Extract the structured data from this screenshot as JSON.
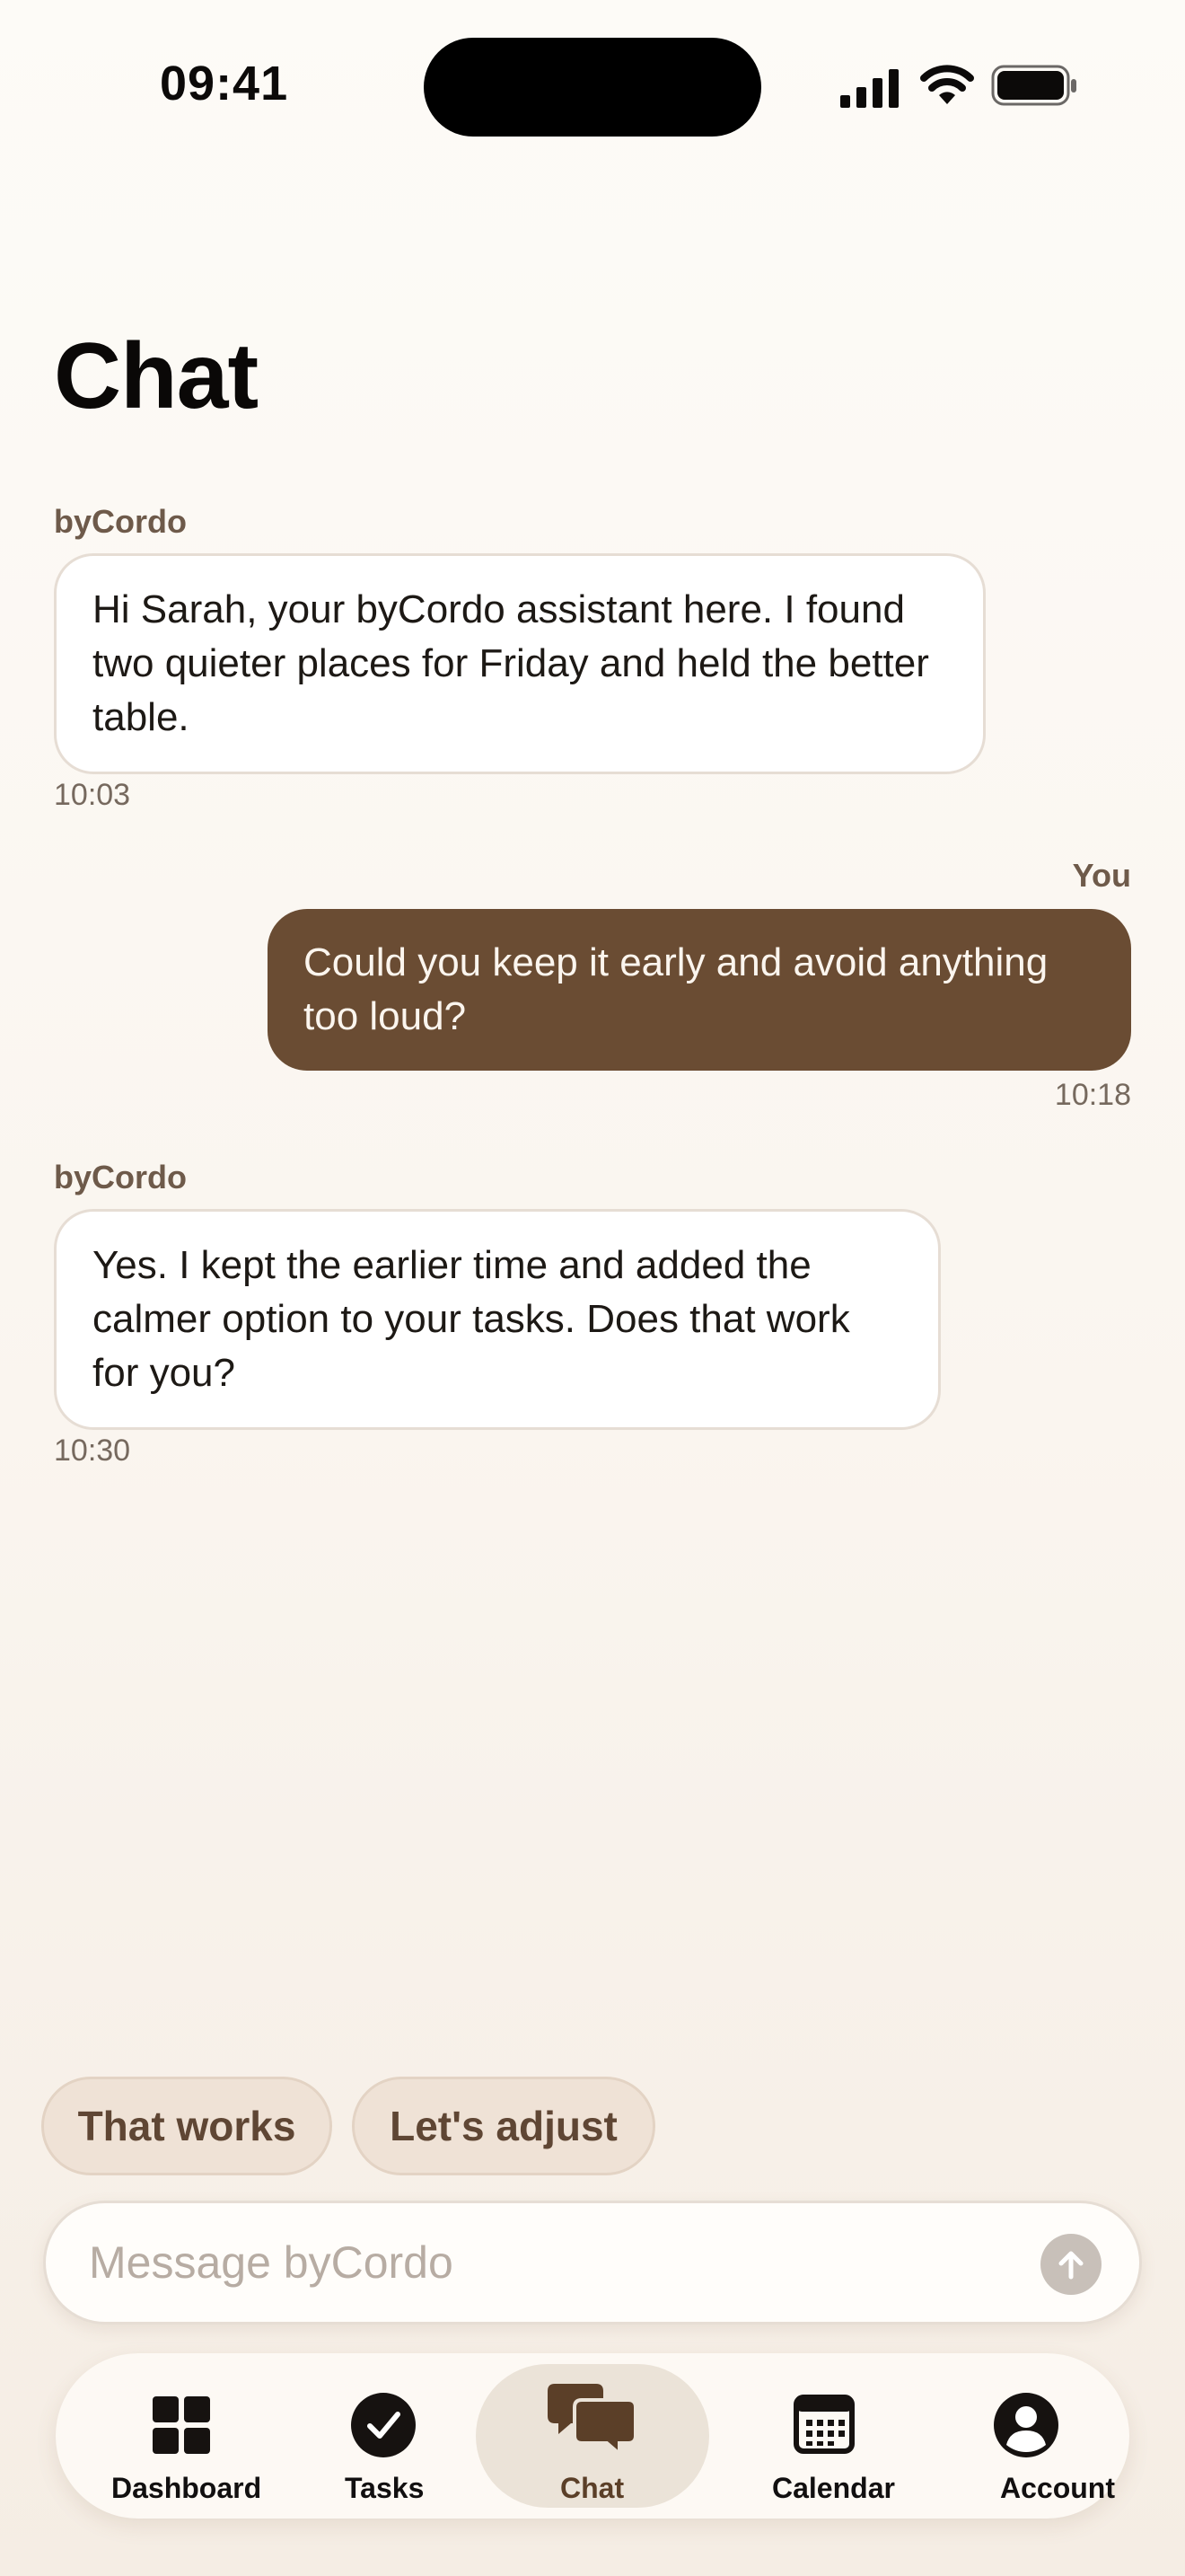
{
  "status_bar": {
    "time": "09:41"
  },
  "header": {
    "title": "Chat"
  },
  "messages": [
    {
      "sender": "byCordo",
      "text": "Hi Sarah, your byCordo assistant here. I found two quieter places for Friday and held the better table.",
      "time": "10:03",
      "direction": "incoming"
    },
    {
      "sender": "You",
      "text": "Could you keep it early and avoid anything too loud?",
      "time": "10:18",
      "direction": "outgoing"
    },
    {
      "sender": "byCordo",
      "text": "Yes. I kept the earlier time and added the calmer option to your tasks. Does that work for you?",
      "time": "10:30",
      "direction": "incoming"
    }
  ],
  "quick_replies": [
    "That works",
    "Let's adjust"
  ],
  "composer": {
    "placeholder": "Message byCordo",
    "value": ""
  },
  "tabs": [
    {
      "label": "Dashboard",
      "icon": "grid-icon",
      "active": false
    },
    {
      "label": "Tasks",
      "icon": "check-circle-icon",
      "active": false
    },
    {
      "label": "Chat",
      "icon": "chat-bubbles-icon",
      "active": true
    },
    {
      "label": "Calendar",
      "icon": "calendar-icon",
      "active": false
    },
    {
      "label": "Account",
      "icon": "person-circle-icon",
      "active": false
    }
  ],
  "colors": {
    "accent": "#6a4c33",
    "background": "#fdfbf7",
    "chip": "#efe2d6"
  }
}
